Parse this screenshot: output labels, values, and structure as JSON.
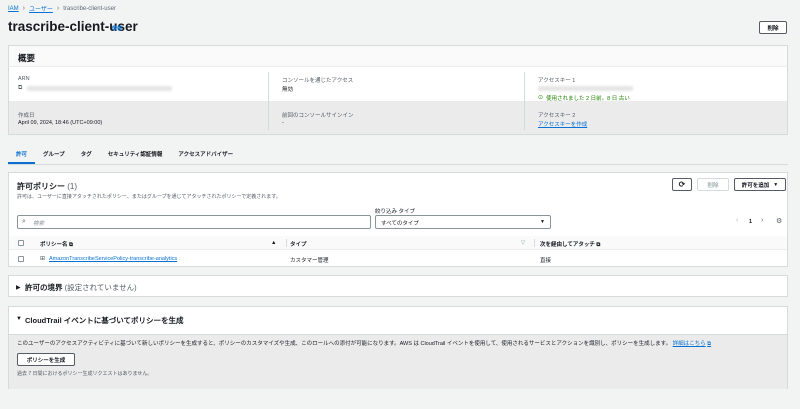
{
  "breadcrumb": {
    "iam": "IAM",
    "users": "ユーザー",
    "current": "trascribe-client-user"
  },
  "page": {
    "title": "trascribe-client-user",
    "info": "情報",
    "delete": "削除"
  },
  "summary": {
    "title": "概要",
    "arn_label": "ARN",
    "console_label": "コンソールを通じたアクセス",
    "console_value": "無効",
    "key1_label": "アクセスキー 1",
    "key1_status": "使用されました 2 日前。8 日 古い",
    "created_label": "作成日",
    "created_value": "April 09, 2024, 18:46 (UTC+09:00)",
    "last_signin_label": "前回のコンソールサインイン",
    "last_signin_value": "-",
    "key2_label": "アクセスキー 2",
    "key2_link": "アクセスキーを作成"
  },
  "tabs": [
    "許可",
    "グループ",
    "タグ",
    "セキュリティ認証情報",
    "アクセスアドバイザー"
  ],
  "policies": {
    "title": "許可ポリシー",
    "count": "(1)",
    "description": "許可は、ユーザーに直接アタッチされたポリシー、またはグループを通じてアタッチされたポリシーで定義されます。",
    "delete": "削除",
    "add": "許可を追加",
    "search_placeholder": "検索",
    "filter_label": "絞り込み タイプ",
    "filter_value": "すべてのタイプ",
    "page": "1",
    "columns": {
      "name": "ポリシー名",
      "type": "タイプ",
      "attached": "次を経由してアタッチ"
    },
    "rows": [
      {
        "name": "AmazonTranscribeServicePolicy-transcribe-analytics",
        "type": "カスタマー管理",
        "attached": "直接"
      }
    ]
  },
  "boundary": {
    "title": "許可の境界",
    "subtitle": "(設定されていません)"
  },
  "cloudtrail": {
    "title": "CloudTrail イベントに基づいてポリシーを生成",
    "description": "このユーザーのアクセスアクティビティに基づいて新しいポリシーを生成すると、ポリシーのカスタマイズや生成、このロールへの添付が可能になります。AWS は CloudTrail イベントを使用して、使用されるサービスとアクションを識別し、ポリシーを生成します。",
    "learn_more": "詳細はこちら",
    "button": "ポリシーを生成",
    "note": "過去 7 日間におけるポリシー生成リクエストはありません。"
  }
}
